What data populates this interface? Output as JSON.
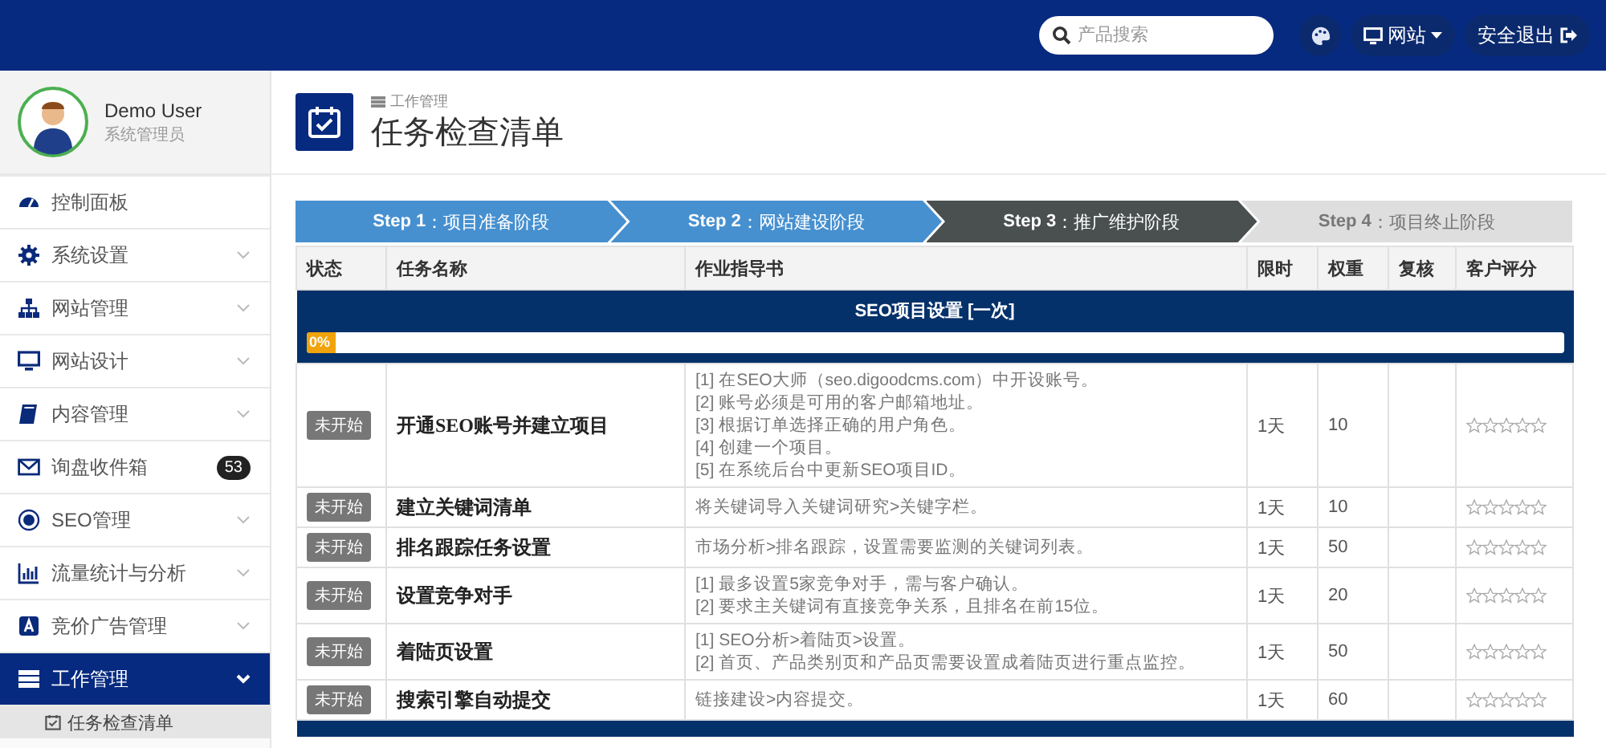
{
  "topbar": {
    "search": {
      "placeholder": "产品搜索"
    },
    "site_menu": {
      "label": "网站"
    },
    "logout": {
      "label": "安全退出"
    }
  },
  "user": {
    "name": "Demo User",
    "role": "系统管理员"
  },
  "sidebar": {
    "items": [
      {
        "label": "控制面板",
        "kind": "link",
        "expanded": false,
        "selected": false
      },
      {
        "label": "系统设置",
        "kind": "menu",
        "expanded": false,
        "selected": false
      },
      {
        "label": "网站管理",
        "kind": "menu",
        "expanded": false,
        "selected": false
      },
      {
        "label": "网站设计",
        "kind": "menu",
        "expanded": false,
        "selected": false
      },
      {
        "label": "内容管理",
        "kind": "menu",
        "expanded": false,
        "selected": false
      },
      {
        "label": "询盘收件箱",
        "kind": "link",
        "expanded": false,
        "selected": false,
        "badge": "53"
      },
      {
        "label": "SEO管理",
        "kind": "menu",
        "expanded": false,
        "selected": false
      },
      {
        "label": "流量统计与分析",
        "kind": "menu",
        "expanded": false,
        "selected": false
      },
      {
        "label": "竞价广告管理",
        "kind": "menu",
        "expanded": false,
        "selected": false
      },
      {
        "label": "工作管理",
        "kind": "menu",
        "expanded": true,
        "selected": true,
        "children": [
          {
            "label": "任务检查清单",
            "selected": true
          }
        ]
      }
    ]
  },
  "page": {
    "breadcrumb": "工作管理",
    "title": "任务检查清单"
  },
  "steps": [
    {
      "label": "**Step 1**：项目准备阶段",
      "kind": "done"
    },
    {
      "label": "**Step 2**：网站建设阶段",
      "kind": "done"
    },
    {
      "label": "**Step 3**：推广维护阶段",
      "kind": "current"
    },
    {
      "label": "**Step 4**：项目终止阶段",
      "kind": "pending"
    }
  ],
  "table": {
    "columns": [
      "状态",
      "任务名称",
      "作业指导书",
      "限时",
      "权重",
      "复核",
      "客户评分"
    ],
    "sections": [
      {
        "title": "SEO项目设置 [一次]",
        "progress": {
          "level": 0,
          "label": "0%"
        },
        "rows": [
          {
            "status": "未开始",
            "name": "开通SEO账号并建立项目",
            "guide": [
              "[1] 在SEO大师（seo.digoodcms.com）中开设账号。",
              "[2] 账号必须是可用的客户邮箱地址。",
              "[3] 根据订单选择正确的用户角色。",
              "[4] 创建一个项目。",
              "[5] 在系统后台中更新SEO项目ID。"
            ],
            "time_limit": "1天",
            "weight": "10",
            "stars": 0
          },
          {
            "status": "未开始",
            "name": "建立关键词清单",
            "guide": [
              "将关键词导入关键词研究>关键字栏。"
            ],
            "time_limit": "1天",
            "weight": "10",
            "stars": 0
          },
          {
            "status": "未开始",
            "name": "排名跟踪任务设置",
            "guide": [
              "市场分析>排名跟踪，设置需要监测的关键词列表。"
            ],
            "time_limit": "1天",
            "weight": "50",
            "stars": 0
          },
          {
            "status": "未开始",
            "name": "设置竞争对手",
            "guide": [
              "[1] 最多设置5家竞争对手，需与客户确认。",
              "[2] 要求主关键词有直接竞争关系，且排名在前15位。"
            ],
            "time_limit": "1天",
            "weight": "20",
            "stars": 0
          },
          {
            "status": "未开始",
            "name": "着陆页设置",
            "guide": [
              "[1] SEO分析>着陆页>设置。",
              "[2] 首页、产品类别页和产品页需要设置成着陆页进行重点监控。"
            ],
            "time_limit": "1天",
            "weight": "50",
            "stars": 0
          },
          {
            "status": "未开始",
            "name": "搜索引擎自动提交",
            "guide": [
              "链接建设>内容提交。"
            ],
            "time_limit": "1天",
            "weight": "60",
            "stars": 0
          }
        ]
      }
    ]
  }
}
